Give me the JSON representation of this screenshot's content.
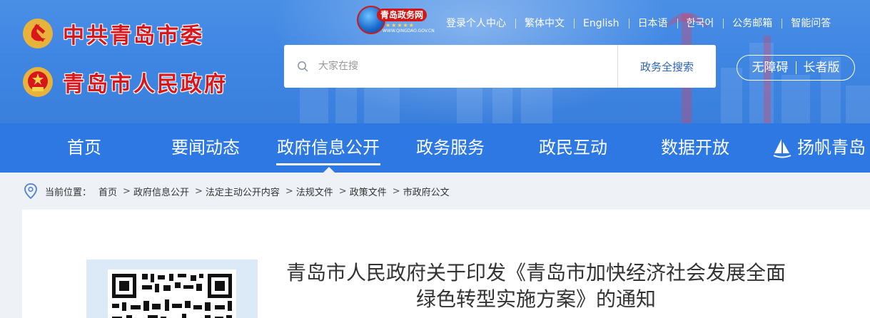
{
  "header": {
    "brand_party": "中共青岛市委",
    "brand_gov": "青岛市人民政府",
    "portal_logo": {
      "name": "青岛政务网",
      "url": "WWW.QINGDAO.GOV.CN"
    },
    "top_links": [
      "登录个人中心",
      "繁体中文",
      "English",
      "日本语",
      "한국어",
      "公务邮箱",
      "智能问答"
    ],
    "search": {
      "placeholder": "大家在搜",
      "button_label": "政务全搜索"
    },
    "accessibility": {
      "barrier_free": "无障碍",
      "elder_mode": "长者版"
    }
  },
  "nav": {
    "items": [
      "首页",
      "要闻动态",
      "政府信息公开",
      "政务服务",
      "政民互动",
      "数据开放",
      "扬帆青岛"
    ],
    "active_index": 2
  },
  "breadcrumb": {
    "label": "当前位置：",
    "items": [
      "首页",
      "政府信息公开",
      "法定主动公开内容",
      "法规文件",
      "政策文件",
      "市政府公文"
    ]
  },
  "document": {
    "title_line1": "青岛市人民政府关于印发《青岛市加快经济社会发展全面",
    "title_line2": "绿色转型实施方案》的通知"
  },
  "colors": {
    "header_blue": "#3f86e3",
    "nav_blue": "#2d78e3",
    "brand_red": "#d8171d",
    "search_button_text": "#2c63b6"
  },
  "icons": {
    "party_emblem": "party-emblem-icon",
    "national_emblem": "national-emblem-icon",
    "search": "search-icon",
    "sail": "sail-icon",
    "location": "location-pin-icon"
  }
}
